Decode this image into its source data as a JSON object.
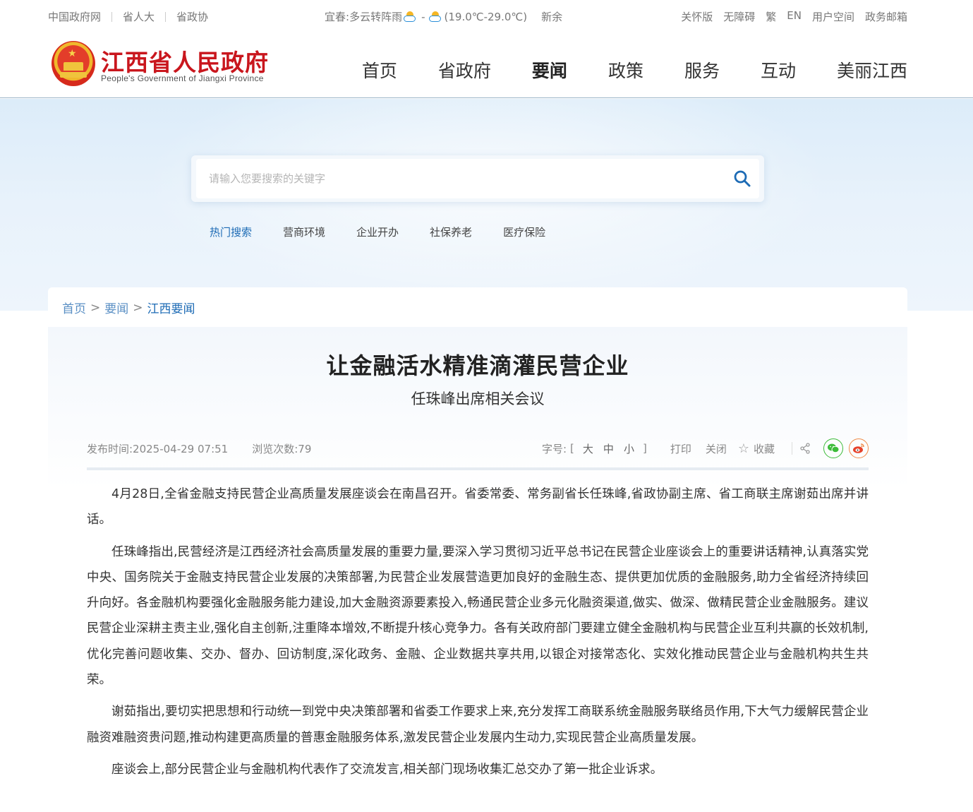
{
  "topbar": {
    "links": [
      "中国政府网",
      "省人大",
      "省政协"
    ],
    "weather": {
      "city": "宜春:",
      "desc": "多云转阵雨",
      "dash": "-",
      "temp": "(19.0℃-29.0℃)",
      "extra": "新余"
    },
    "right": [
      "关怀版",
      "无障碍",
      "繁",
      "EN",
      "用户空间",
      "政务邮箱"
    ]
  },
  "header": {
    "logo_cn": "江西省人民政府",
    "logo_en": "People's Government of Jiangxi Province",
    "nav": [
      "首页",
      "省政府",
      "要闻",
      "政策",
      "服务",
      "互动",
      "美丽江西"
    ],
    "nav_active_index": 2
  },
  "search": {
    "placeholder": "请输入您要搜索的关键字",
    "hot_title": "热门搜索",
    "hot_items": [
      "营商环境",
      "企业开办",
      "社保养老",
      "医疗保险"
    ]
  },
  "breadcrumb": {
    "items": [
      "首页",
      "要闻",
      "江西要闻"
    ],
    "sep": ">"
  },
  "article": {
    "title": "让金融活水精准滴灌民营企业",
    "subtitle": "任珠峰出席相关会议",
    "publish": "发布时间:2025-04-29 07:51",
    "views": "浏览次数:79",
    "fontsize_label": "字号:",
    "bracket_open": "[",
    "bracket_close": "]",
    "sizes": [
      "大",
      "中",
      "小"
    ],
    "print": "打印",
    "close": "关闭",
    "favorite": "收藏",
    "paragraphs": [
      "4月28日,全省金融支持民营企业高质量发展座谈会在南昌召开。省委常委、常务副省长任珠峰,省政协副主席、省工商联主席谢茹出席并讲话。",
      "任珠峰指出,民营经济是江西经济社会高质量发展的重要力量,要深入学习贯彻习近平总书记在民营企业座谈会上的重要讲话精神,认真落实党中央、国务院关于金融支持民营企业发展的决策部署,为民营企业发展营造更加良好的金融生态、提供更加优质的金融服务,助力全省经济持续回升向好。各金融机构要强化金融服务能力建设,加大金融资源要素投入,畅通民营企业多元化融资渠道,做实、做深、做精民营企业金融服务。建议民营企业深耕主责主业,强化自主创新,注重降本增效,不断提升核心竞争力。各有关政府部门要建立健全金融机构与民营企业互利共赢的长效机制,优化完善问题收集、交办、督办、回访制度,深化政务、金融、企业数据共享共用,以银企对接常态化、实效化推动民营企业与金融机构共生共荣。",
      "谢茹指出,要切实把思想和行动统一到党中央决策部署和省委工作要求上来,充分发挥工商联系统金融服务联络员作用,下大气力缓解民营企业融资难融资贵问题,推动构建更高质量的普惠金融服务体系,激发民营企业发展内生动力,实现民营企业高质量发展。",
      "座谈会上,部分民营企业与金融机构代表作了交流发言,相关部门现场收集汇总交办了第一批企业诉求。"
    ]
  },
  "colors": {
    "brand_red": "#c9161d",
    "link_blue": "#1d6bb5",
    "wechat_green": "#3dbc3a",
    "weibo_orange": "#f08c4a"
  },
  "icons": [
    "national-emblem-icon",
    "weather-icon",
    "search-icon",
    "star-icon",
    "share-icon",
    "wechat-icon",
    "weibo-icon"
  ]
}
